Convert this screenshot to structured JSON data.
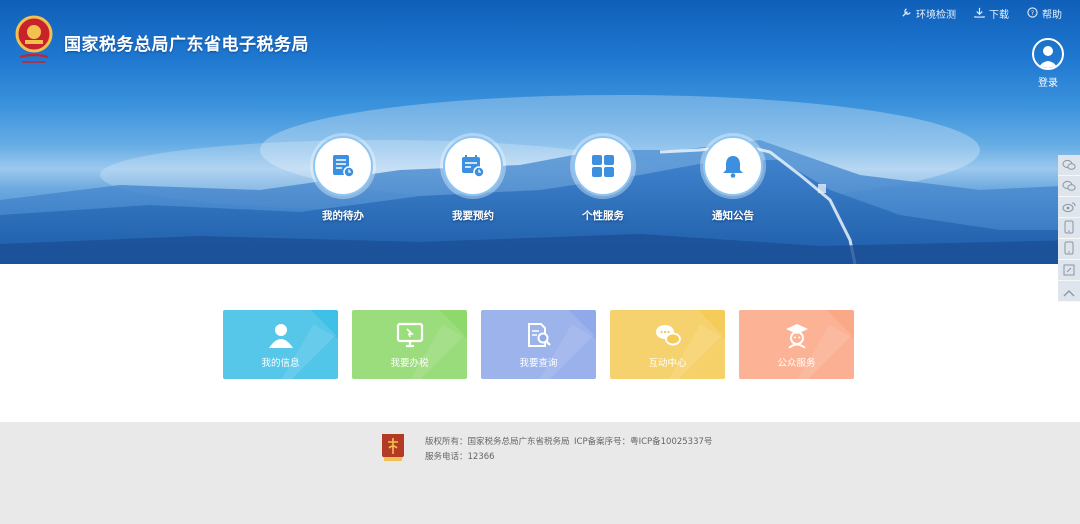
{
  "header": {
    "site_title": "国家税务总局广东省电子税务局",
    "top_links": [
      {
        "label": "环境检测",
        "icon": "wrench-icon"
      },
      {
        "label": "下载",
        "icon": "download-icon"
      },
      {
        "label": "帮助",
        "icon": "help-icon"
      }
    ],
    "login_label": "登录"
  },
  "quick_circles": [
    {
      "label": "我的待办",
      "icon": "document-list-icon"
    },
    {
      "label": "我要预约",
      "icon": "calendar-clock-icon"
    },
    {
      "label": "个性服务",
      "icon": "grid-apps-icon"
    },
    {
      "label": "通知公告",
      "icon": "bell-icon"
    }
  ],
  "tiles": [
    {
      "label": "我的信息",
      "icon": "user-icon",
      "color": "#3fc0e6"
    },
    {
      "label": "我要办税",
      "icon": "monitor-icon",
      "color": "#8ed86c"
    },
    {
      "label": "我要查询",
      "icon": "search-document-icon",
      "color": "#8fa9ea"
    },
    {
      "label": "互动中心",
      "icon": "chat-bubbles-icon",
      "color": "#f5cc5a"
    },
    {
      "label": "公众服务",
      "icon": "graduate-icon",
      "color": "#fba887"
    }
  ],
  "sidebar_tools": [
    "wechat-icon",
    "wechat-icon",
    "weibo-icon",
    "mobile-icon",
    "mobile-icon",
    "edit-icon",
    "back-to-top-icon"
  ],
  "footer": {
    "copyright": "版权所有：国家税务总局广东省税务局",
    "icp": "ICP备案序号：粤ICP备10025337号",
    "phone": "服务电话：12366"
  }
}
